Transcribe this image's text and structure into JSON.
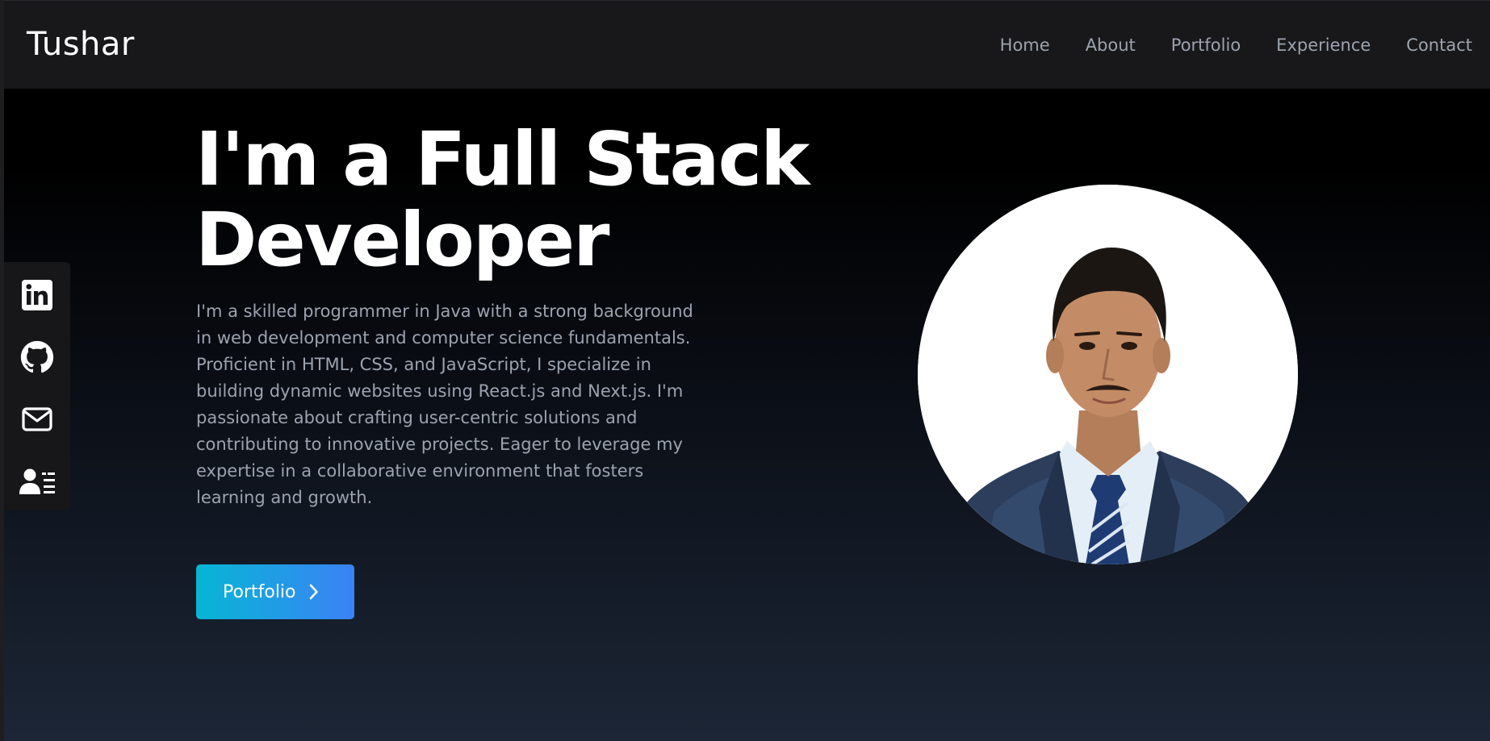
{
  "header": {
    "brand": "Tushar",
    "nav": [
      "Home",
      "About",
      "Portfolio",
      "Experience",
      "Contact"
    ]
  },
  "social": [
    {
      "icon": "linkedin-icon"
    },
    {
      "icon": "github-icon"
    },
    {
      "icon": "mail-icon"
    },
    {
      "icon": "resume-icon"
    }
  ],
  "hero": {
    "title_line1": "I'm a Full Stack",
    "title_line2": "Developer",
    "description": "I'm a skilled programmer in Java with a strong background in web development and computer science fundamentals. Proficient in HTML, CSS, and JavaScript, I specialize in building dynamic websites using React.js and Next.js. I'm passionate about crafting user-centric solutions and contributing to innovative projects. Eager to leverage my expertise in a collaborative environment that fosters learning and growth.",
    "button_label": "Portfolio"
  },
  "colors": {
    "accent_start": "#06b6d4",
    "accent_end": "#3b82f6",
    "nav_text": "#9ca3af",
    "header_bg": "#18181b"
  }
}
